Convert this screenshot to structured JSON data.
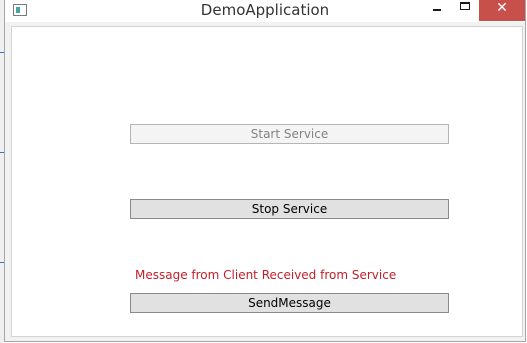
{
  "window": {
    "title": "DemoApplication",
    "close_glyph": "✕",
    "icons": {
      "app": "window-app-icon",
      "minimize": "minimize-icon",
      "maximize": "maximize-icon",
      "close": "close-icon"
    },
    "colors": {
      "close_button": "#c7504a",
      "client_bg": "#ffffff",
      "frame_bg": "#f2f2f2"
    }
  },
  "buttons": {
    "start_service": "Start Service",
    "stop_service": "Stop Service",
    "send_message": "SendMessage"
  },
  "start_service_enabled": false,
  "message_label": {
    "text": "Message from Client Received from Service",
    "color": "#c0202a"
  }
}
